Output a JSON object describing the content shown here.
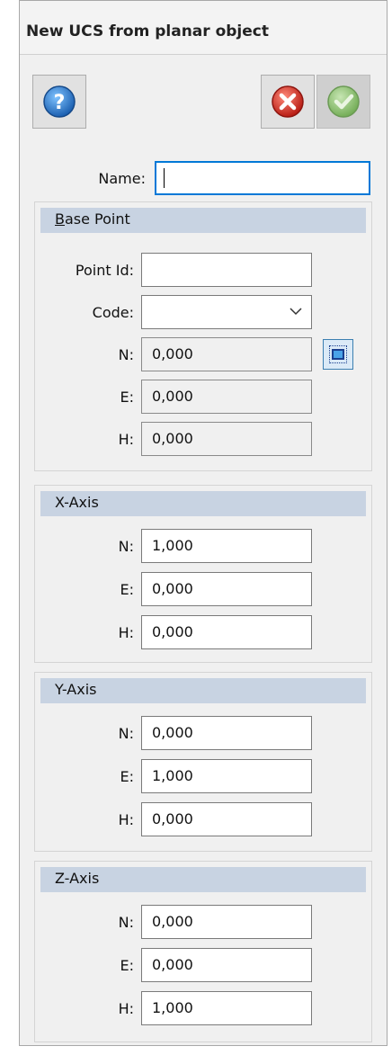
{
  "window": {
    "title": "New UCS from planar object"
  },
  "toolbar": {
    "help_icon": "help-icon",
    "cancel_icon": "cancel-icon",
    "ok_icon": "ok-icon"
  },
  "name_field": {
    "label": "Name:",
    "value": ""
  },
  "base_point": {
    "title_first": "B",
    "title_rest": "ase Point",
    "point_id_label": "Point Id:",
    "point_id_value": "",
    "code_label": "Code:",
    "code_value": "",
    "n_label": "N:",
    "n_value": "0,000",
    "e_label": "E:",
    "e_value": "0,000",
    "h_label": "H:",
    "h_value": "0,000",
    "pick_icon": "pick-point-icon"
  },
  "x_axis": {
    "title": "X-Axis",
    "n_label": "N:",
    "n_value": "1,000",
    "e_label": "E:",
    "e_value": "0,000",
    "h_label": "H:",
    "h_value": "0,000"
  },
  "y_axis": {
    "title": "Y-Axis",
    "n_label": "N:",
    "n_value": "0,000",
    "e_label": "E:",
    "e_value": "1,000",
    "h_label": "H:",
    "h_value": "0,000"
  },
  "z_axis": {
    "title": "Z-Axis",
    "n_label": "N:",
    "n_value": "0,000",
    "e_label": "E:",
    "e_value": "0,000",
    "h_label": "H:",
    "h_value": "1,000"
  }
}
